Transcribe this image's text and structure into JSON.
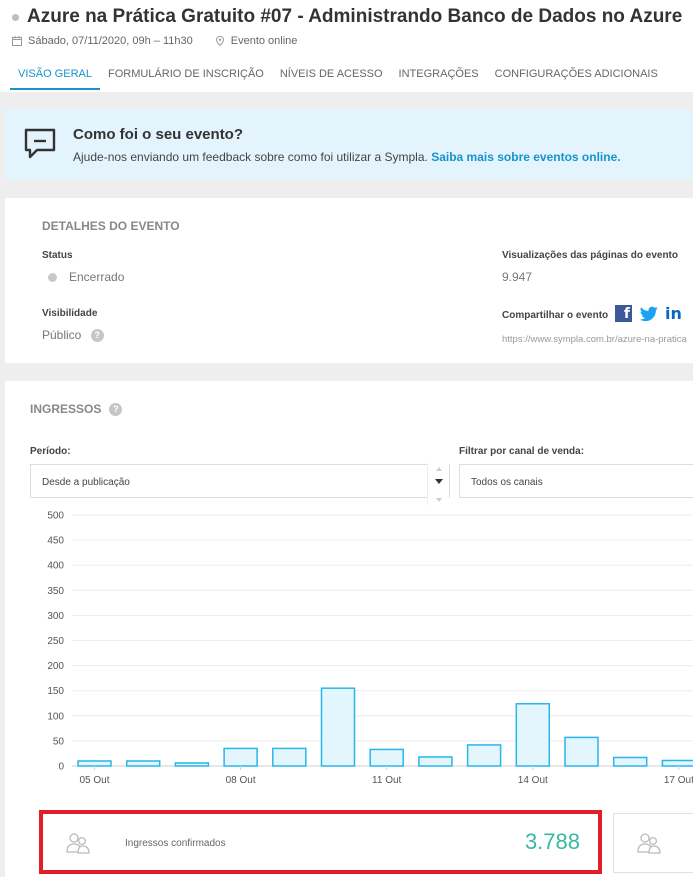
{
  "event": {
    "title": "Azure na Prática Gratuito #07 - Administrando Banco de Dados no Azure",
    "date": "Sábado, 07/11/2020, 09h – 11h30",
    "location": "Evento online"
  },
  "tabs": [
    {
      "label": "VISÃO GERAL",
      "active": true
    },
    {
      "label": "FORMULÁRIO DE INSCRIÇÃO"
    },
    {
      "label": "NÍVEIS DE ACESSO"
    },
    {
      "label": "INTEGRAÇÕES"
    },
    {
      "label": "CONFIGURAÇÕES ADICIONAIS"
    }
  ],
  "feedback": {
    "title": "Como foi o seu evento?",
    "text": "Ajude-nos enviando um feedback sobre como foi utilizar a Sympla.",
    "link": "Saiba mais sobre eventos online."
  },
  "details": {
    "section_title": "DETALHES DO EVENTO",
    "status_label": "Status",
    "status_value": "Encerrado",
    "visibility_label": "Visibilidade",
    "visibility_value": "Público",
    "visibility_help": "?",
    "views_label": "Visualizações das páginas do evento",
    "views_value": "9.947",
    "share_label": "Compartilhar o evento",
    "share_icons": [
      "facebook-icon",
      "twitter-icon",
      "linkedin-icon"
    ],
    "share_linkedin_text": "in",
    "share_url": "https://www.sympla.com.br/azure-na-pratica"
  },
  "ingressos": {
    "section_title": "INGRESSOS",
    "help": "?",
    "period_label": "Período:",
    "period_value": "Desde a publicação",
    "channel_label": "Filtrar por canal de venda:",
    "channel_value": "Todos os canais"
  },
  "chart_data": {
    "type": "bar",
    "x_tick_labels": [
      "05 Out",
      "08 Out",
      "11 Out",
      "14 Out",
      "17 Out"
    ],
    "values": [
      10,
      10,
      6,
      35,
      35,
      155,
      33,
      18,
      42,
      124,
      57,
      17,
      11
    ],
    "ylim": [
      0,
      500
    ],
    "yticks": [
      0,
      50,
      100,
      150,
      200,
      250,
      300,
      350,
      400,
      450,
      500
    ],
    "grid": true,
    "bar_fill": "#e3f5fd",
    "bar_stroke": "#29b6ea"
  },
  "stats": {
    "confirmed_label": "Ingressos confirmados",
    "confirmed_value": "3.788"
  },
  "colors": {
    "accent": "#1793ce",
    "stat_value": "#35b9a5",
    "highlight": "#e41e26"
  }
}
